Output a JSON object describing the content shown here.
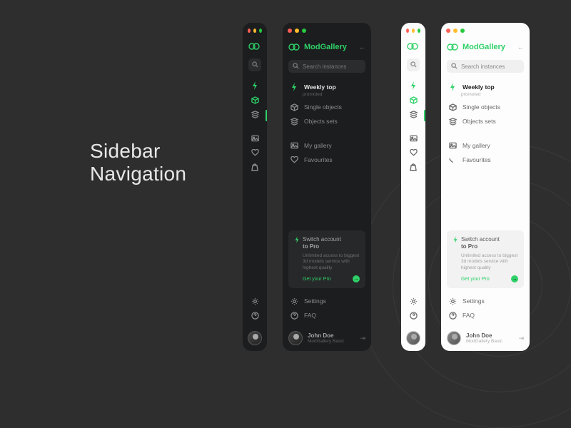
{
  "heading": {
    "line1": "Sidebar",
    "line2": "Navigation"
  },
  "brand": "ModGallery",
  "search": {
    "placeholder": "Search instances"
  },
  "nav": {
    "primary": [
      {
        "key": "weekly",
        "label": "Weekly top",
        "sub": "promoted",
        "icon": "bolt",
        "active": true
      },
      {
        "key": "single",
        "label": "Single objects",
        "icon": "cube"
      },
      {
        "key": "sets",
        "label": "Objects sets",
        "icon": "stack"
      }
    ],
    "secondary": [
      {
        "key": "gallery",
        "label": "My gallery",
        "icon": "image"
      },
      {
        "key": "fav",
        "label": "Favourites",
        "icon": "heart"
      }
    ],
    "tertiary": [
      {
        "key": "cart",
        "label": "",
        "icon": "bag"
      }
    ],
    "bottom": [
      {
        "key": "settings",
        "label": "Settings",
        "icon": "gear"
      },
      {
        "key": "faq",
        "label": "FAQ",
        "icon": "help"
      }
    ]
  },
  "promo": {
    "title_pre": "Switch account",
    "title_bold": "to Pro",
    "desc": "Unlimited access to biggest 3d models service with highest quality",
    "cta": "Get your Pro"
  },
  "user": {
    "name": "John Doe",
    "role": "ModGallery Basic"
  }
}
